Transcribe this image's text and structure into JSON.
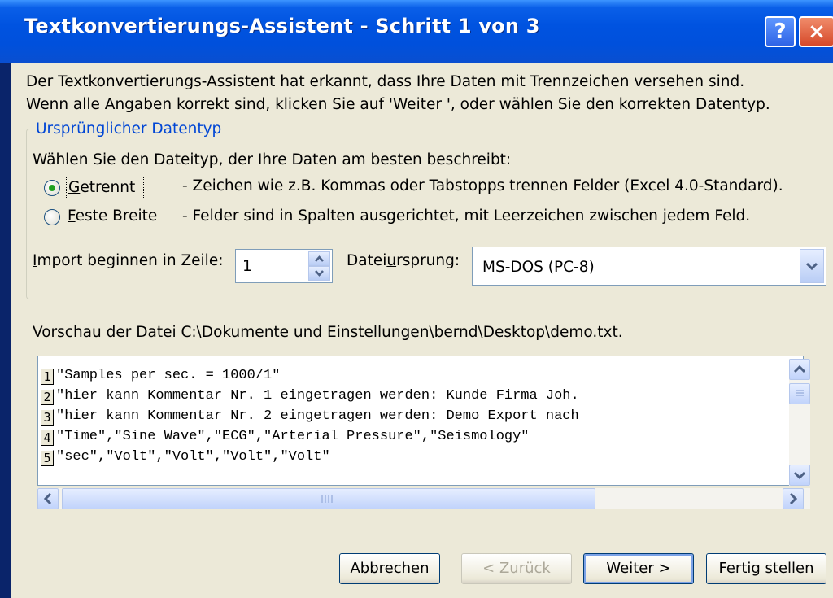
{
  "window": {
    "title": "Textkonvertierungs-Assistent - Schritt 1 von 3",
    "help_glyph": "?",
    "close_glyph": "×"
  },
  "intro": {
    "line1": "Der Textkonvertierungs-Assistent hat erkannt, dass Ihre Daten mit Trennzeichen versehen sind.",
    "line2": "Wenn alle Angaben korrekt sind, klicken Sie auf 'Weiter ', oder wählen Sie den korrekten Datentyp."
  },
  "datatype_group": {
    "title": "Ursprünglicher Datentyp",
    "instruction": "Wählen Sie den Dateityp, der Ihre Daten am besten beschreibt:",
    "options": [
      {
        "label_first": "G",
        "label_rest": "etrennt",
        "description": "- Zeichen wie z.B. Kommas oder Tabstopps trennen Felder (Excel 4.0-Standard).",
        "selected": true
      },
      {
        "label_first": "F",
        "label_rest": "este Breite",
        "description": "- Felder sind in Spalten ausgerichtet, mit Leerzeichen zwischen jedem Feld.",
        "selected": false
      }
    ]
  },
  "import_row": {
    "label_first": "I",
    "label_rest": "mport beginnen in Zeile:",
    "value": "1"
  },
  "origin": {
    "label_pre": "Datei",
    "label_u": "u",
    "label_post": "rsprung:",
    "value": "MS-DOS (PC-8)"
  },
  "preview": {
    "label": "Vorschau der Datei C:\\Dokumente und Einstellungen\\bernd\\Desktop\\demo.txt.",
    "rows": [
      {
        "num": "1",
        "text": "\"Samples per sec. = 1000/1\""
      },
      {
        "num": "2",
        "text": "\"hier kann Kommentar Nr. 1 eingetragen werden: Kunde Firma Joh."
      },
      {
        "num": "3",
        "text": "\"hier kann Kommentar Nr. 2 eingetragen werden: Demo Export nach"
      },
      {
        "num": "4",
        "text": "\"Time\",\"Sine Wave\",\"ECG\",\"Arterial Pressure\",\"Seismology\""
      },
      {
        "num": "5",
        "text": "\"sec\",\"Volt\",\"Volt\",\"Volt\",\"Volt\""
      }
    ]
  },
  "buttons": {
    "cancel": "Abbrechen",
    "back": "< Zurück",
    "next_u": "W",
    "next_rest": "eiter >",
    "finish_pre": "F",
    "finish_u": "e",
    "finish_post": "rtig stellen"
  }
}
